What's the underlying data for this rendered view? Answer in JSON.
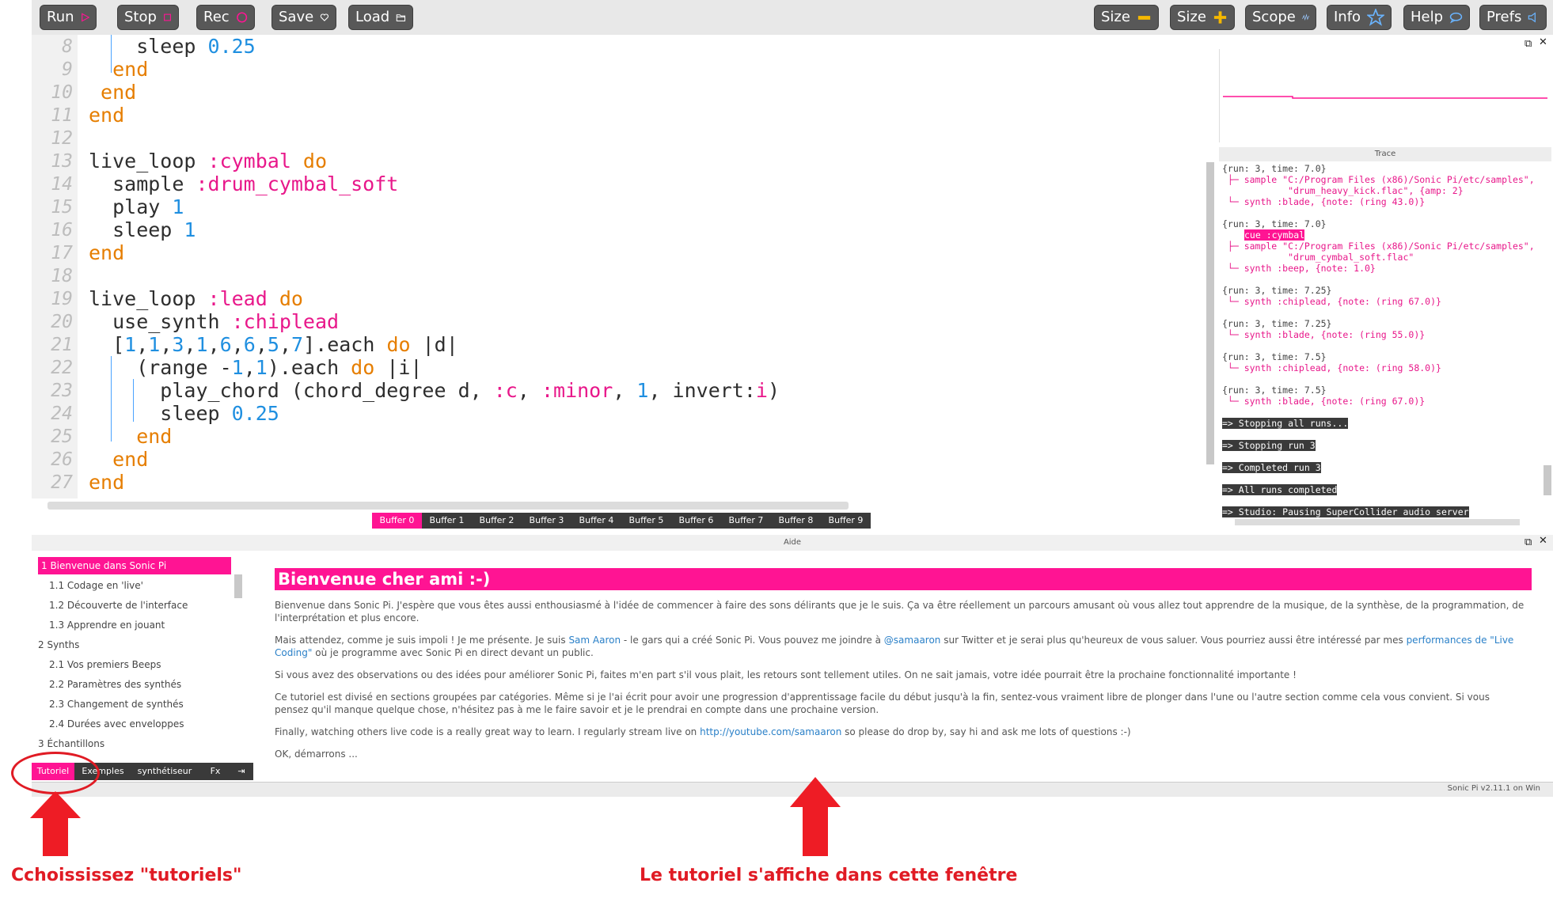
{
  "toolbar": {
    "run_label": "Run",
    "stop_label": "Stop",
    "rec_label": "Rec",
    "save_label": "Save",
    "load_label": "Load",
    "size_down_label": "Size",
    "size_up_label": "Size",
    "scope_label": "Scope",
    "info_label": "Info",
    "help_label": "Help",
    "prefs_label": "Prefs"
  },
  "colors": {
    "accent": "#ff1493",
    "keyword": "#e67e00",
    "number": "#1f8fe0",
    "button_bg": "#585858",
    "annotation_red": "#e01b24"
  },
  "editor": {
    "line_numbers": [
      "8",
      "9",
      "10",
      "11",
      "12",
      "13",
      "14",
      "15",
      "16",
      "17",
      "18",
      "19",
      "20",
      "21",
      "22",
      "23",
      "24",
      "25",
      "26",
      "27"
    ]
  },
  "buffers": [
    "Buffer 0",
    "Buffer 1",
    "Buffer 2",
    "Buffer 3",
    "Buffer 4",
    "Buffer 5",
    "Buffer 6",
    "Buffer 7",
    "Buffer 8",
    "Buffer 9"
  ],
  "trace": {
    "title": "Trace",
    "lines": [
      "{run: 3, time: 7.0}",
      " ├─ sample \"C:/Program Files (x86)/Sonic Pi/etc/samples\",",
      "            \"drum_heavy_kick.flac\", {amp: 2}",
      " └─ synth :blade, {note: (ring 43.0)}",
      "{run: 3, time: 7.0}",
      "cue :cymbal",
      " ├─ sample \"C:/Program Files (x86)/Sonic Pi/etc/samples\",",
      "            \"drum_cymbal_soft.flac\"",
      " └─ synth :beep, {note: 1.0}",
      "{run: 3, time: 7.25}",
      " └─ synth :chiplead, {note: (ring 67.0)}",
      "{run: 3, time: 7.25}",
      " └─ synth :blade, {note: (ring 55.0)}",
      "{run: 3, time: 7.5}",
      " └─ synth :chiplead, {note: (ring 58.0)}",
      "{run: 3, time: 7.5}",
      " └─ synth :blade, {note: (ring 67.0)}",
      "=> Stopping all runs...",
      "=> Stopping run 3",
      "=> Completed run 3",
      "=> All runs completed",
      "=> Studio: Pausing SuperCollider audio server"
    ]
  },
  "help": {
    "bar_title": "Aide",
    "toc": [
      "1 Bienvenue dans Sonic Pi",
      "1.1 Codage en 'live'",
      "1.2 Découverte de l'interface",
      "1.3 Apprendre en jouant",
      "2 Synths",
      "2.1 Vos premiers Beeps",
      "2.2 Paramètres des synthés",
      "2.3 Changement de synthés",
      "2.4 Durées avec enveloppes",
      "3 Échantillons"
    ],
    "tabs": [
      "Tutoriel",
      "Exemples",
      "synthétiseur",
      "Fx"
    ],
    "title": "Bienvenue cher ami :-)",
    "p1": "Bienvenue dans Sonic Pi. J'espère que vous êtes aussi enthousiasmé à l'idée de commencer à faire des sons délirants que je le suis. Ça va être réellement un parcours amusant où vous allez tout apprendre de la musique, de la synthèse, de la programmation, de l'interprétation et plus encore.",
    "p2_a": "Mais attendez, comme je suis impoli ! Je me présente. Je suis ",
    "p2_link1": "Sam Aaron",
    "p2_b": " - le gars qui a créé Sonic Pi. Vous pouvez me joindre à ",
    "p2_link2": "@samaaron",
    "p2_c": " sur Twitter et je serai plus qu'heureux de vous saluer. Vous pourriez aussi être intéressé par mes ",
    "p2_link3": "performances de \"Live Coding\"",
    "p2_d": " où je programme avec Sonic Pi en direct devant un public.",
    "p3": "Si vous avez des observations ou des idées pour améliorer Sonic Pi, faites m'en part s'il vous plait, les retours sont tellement utiles. On ne sait jamais, votre idée pourrait être la prochaine fonctionnalité importante !",
    "p4": "Ce tutoriel est divisé en sections groupées par catégories. Même si je l'ai écrit pour avoir une progression d'apprentissage facile du début jusqu'à la fin, sentez-vous vraiment libre de plonger dans l'une ou l'autre section comme cela vous convient. Si vous pensez qu'il manque quelque chose, n'hésitez pas à me le faire savoir et je le prendrai en compte dans une prochaine version.",
    "p5_a": "Finally, watching others live code is a really great way to learn. I regularly stream live on ",
    "p5_link": "http://youtube.com/samaaron",
    "p5_b": " so please do drop by, say hi and ask me lots of questions :-)",
    "p6": "OK, démarrons ..."
  },
  "status": "Sonic Pi v2.11.1 on Win",
  "annotations": {
    "left": "Cchoississez \"tutoriels\"",
    "right": "Le tutoriel s'affiche dans cette fenêtre"
  }
}
